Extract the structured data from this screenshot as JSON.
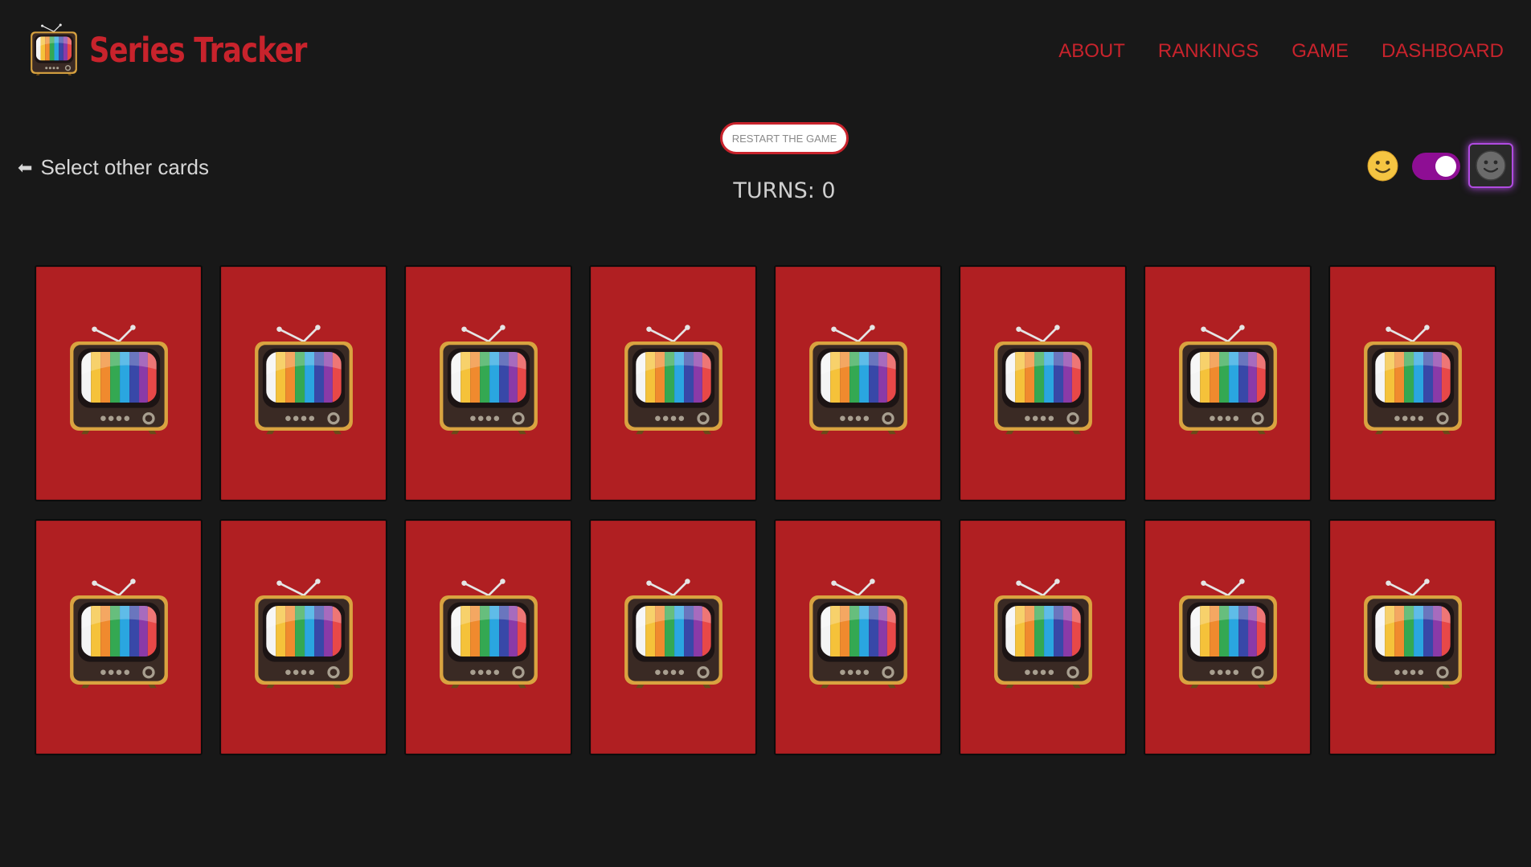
{
  "header": {
    "logo_icon": "retro-tv-icon",
    "title": "Series Tracker",
    "nav": [
      "ABOUT",
      "RANKINGS",
      "GAME",
      "DASHBOARD"
    ]
  },
  "game": {
    "back_label": "Select other cards",
    "back_icon": "arrow-left-icon",
    "restart_label": "RESTART THE GAME",
    "turns_label": "TURNS: 0",
    "card_back_icon": "retro-tv-icon",
    "cards_face_down": 16
  },
  "theme": {
    "light_icon": "smiley-face-icon",
    "dark_icon": "dark-smiley-face-icon",
    "dark_mode_on": true
  },
  "colors": {
    "background": "#181818",
    "accent": "#c8232c",
    "card": "#b01f22",
    "toggle": "#8e0e94"
  }
}
